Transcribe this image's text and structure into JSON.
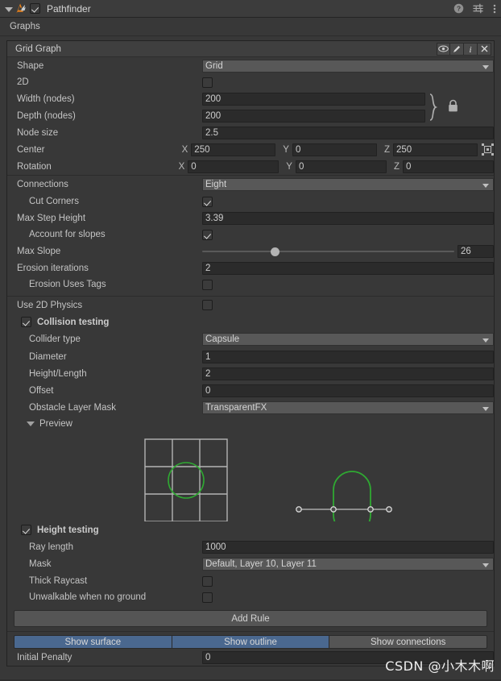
{
  "component": {
    "title": "Pathfinder",
    "enabled": true,
    "logo_icon": "astar-logo-icon",
    "foldout_icon": "foldout-triangle-icon",
    "header_icons": [
      "help-icon",
      "settings-sliders-icon",
      "more-menu-icon"
    ]
  },
  "graphs_section": {
    "label": "Graphs"
  },
  "graph": {
    "title": "Grid Graph",
    "title_icons": [
      "eye-icon",
      "pencil-icon",
      "info-icon",
      "close-icon"
    ],
    "shape": {
      "label": "Shape",
      "value": "Grid"
    },
    "two_d": {
      "label": "2D",
      "checked": false
    },
    "width_nodes": {
      "label": "Width (nodes)",
      "value": "200"
    },
    "depth_nodes": {
      "label": "Depth (nodes)",
      "value": "200"
    },
    "lock_icon": "lock-icon",
    "node_size": {
      "label": "Node size",
      "value": "2.5"
    },
    "center": {
      "label": "Center",
      "x": "250",
      "y": "0",
      "z": "250",
      "axis_x": "X",
      "axis_y": "Y",
      "axis_z": "Z",
      "gizmo_icon": "center-snap-icon"
    },
    "rotation": {
      "label": "Rotation",
      "x": "0",
      "y": "0",
      "z": "0",
      "axis_x": "X",
      "axis_y": "Y",
      "axis_z": "Z"
    },
    "connections": {
      "label": "Connections",
      "value": "Eight"
    },
    "cut_corners": {
      "label": "Cut Corners",
      "checked": true
    },
    "max_step_height": {
      "label": "Max Step Height",
      "value": "3.39"
    },
    "account_for_slopes": {
      "label": "Account for slopes",
      "checked": true
    },
    "max_slope": {
      "label": "Max Slope",
      "value": "26",
      "slider_pct": 29,
      "min": 0,
      "max": 90
    },
    "erosion_iterations": {
      "label": "Erosion iterations",
      "value": "2"
    },
    "erosion_uses_tags": {
      "label": "Erosion Uses Tags",
      "checked": false
    },
    "use_2d_physics": {
      "label": "Use 2D Physics",
      "checked": false
    }
  },
  "collision": {
    "label": "Collision testing",
    "checked": true,
    "collider_type": {
      "label": "Collider type",
      "value": "Capsule"
    },
    "diameter": {
      "label": "Diameter",
      "value": "1"
    },
    "height_length": {
      "label": "Height/Length",
      "value": "2"
    },
    "offset": {
      "label": "Offset",
      "value": "0"
    },
    "obstacle_layer_mask": {
      "label": "Obstacle Layer Mask",
      "value": "TransparentFX"
    },
    "preview": {
      "label": "Preview",
      "expanded": true,
      "grid_cells": 3,
      "shape_color": "#2fa832",
      "grid_color": "#b4b4b4"
    }
  },
  "height_testing": {
    "label": "Height testing",
    "checked": true,
    "ray_length": {
      "label": "Ray length",
      "value": "1000"
    },
    "mask": {
      "label": "Mask",
      "value": "Default, Layer 10, Layer 11"
    },
    "thick_raycast": {
      "label": "Thick Raycast",
      "checked": false
    },
    "unwalkable_no_ground": {
      "label": "Unwalkable when no ground",
      "checked": false
    }
  },
  "footer": {
    "add_rule_label": "Add Rule",
    "toggles": [
      {
        "label": "Show surface",
        "active": true
      },
      {
        "label": "Show outline",
        "active": true
      },
      {
        "label": "Show connections",
        "active": false
      }
    ],
    "initial_penalty": {
      "label": "Initial Penalty",
      "value": "0"
    },
    "watermark": "CSDN @小木木啊"
  },
  "colors": {
    "background": "#383838",
    "panel": "#3f3f3f",
    "field": "#2b2b2b",
    "popup": "#585858",
    "accent_blue": "#4a688f",
    "green": "#2fa832",
    "text": "#c4c4c4"
  }
}
